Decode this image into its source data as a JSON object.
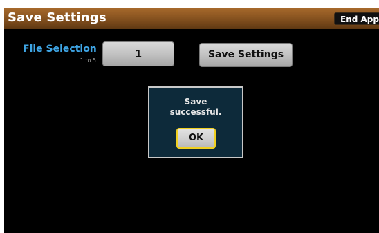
{
  "header": {
    "title": "Save Settings",
    "end_app_label": "End App"
  },
  "file_selection": {
    "label": "File Selection",
    "range": "1 to 5",
    "value": "1"
  },
  "actions": {
    "save_settings_label": "Save Settings"
  },
  "dialog": {
    "message_line_1": "Save",
    "message_line_2": "successful.",
    "ok_label": "OK"
  },
  "colors": {
    "title_bar": "#83501e",
    "label_accent": "#3fa6e6",
    "dialog_bg": "#0d2a3a",
    "focus_outline": "#f0d020"
  }
}
